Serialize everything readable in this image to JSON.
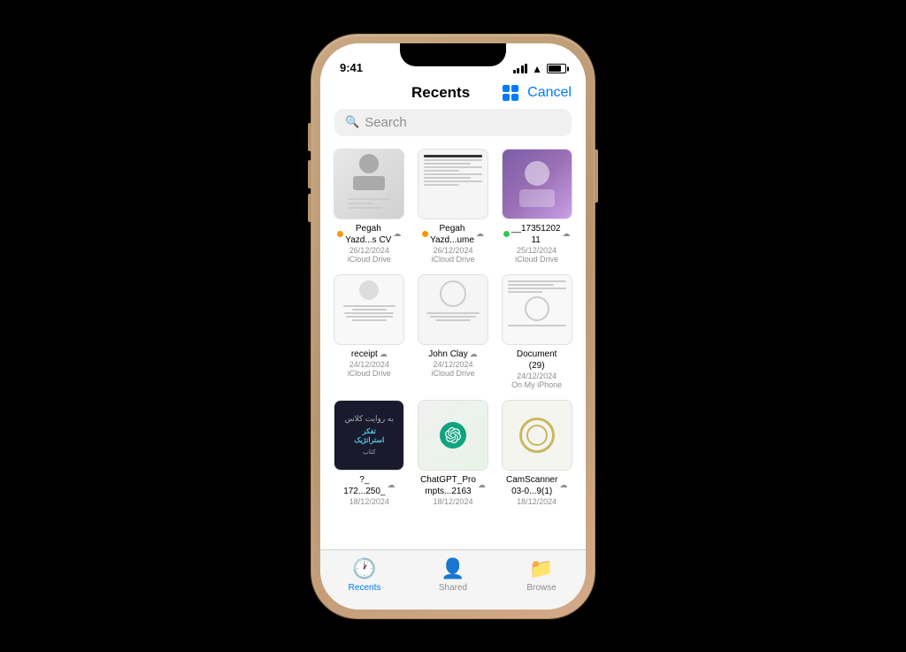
{
  "phone": {
    "status": {
      "time": "9:41",
      "battery_level": 75
    },
    "nav": {
      "title": "Recents",
      "cancel_label": "Cancel"
    },
    "search": {
      "placeholder": "Search"
    },
    "files": [
      {
        "id": "file-1",
        "name": "Pegah\nYazd...s CV",
        "dot_color": "orange",
        "cloud": true,
        "date": "26/12/2024",
        "source": "iCloud Drive",
        "thumb_type": "profile"
      },
      {
        "id": "file-2",
        "name": "Pegah\nYazd...ume",
        "dot_color": "orange",
        "cloud": true,
        "date": "26/12/2024",
        "source": "iCloud Drive",
        "thumb_type": "doc"
      },
      {
        "id": "file-3",
        "name": "__17351202\n11",
        "dot_color": "green",
        "cloud": true,
        "date": "25/12/2024",
        "source": "iCloud Drive",
        "thumb_type": "illustrated"
      },
      {
        "id": "file-4",
        "name": "receipt",
        "dot_color": null,
        "cloud": true,
        "date": "24/12/2024",
        "source": "iCloud Drive",
        "thumb_type": "receipt"
      },
      {
        "id": "file-5",
        "name": "John Clay",
        "dot_color": null,
        "cloud": true,
        "date": "24/12/2024",
        "source": "iCloud Drive",
        "thumb_type": "doc2"
      },
      {
        "id": "file-6",
        "name": "Document\n(29)",
        "dot_color": null,
        "cloud": false,
        "date": "24/12/2024",
        "source": "On My iPhone",
        "thumb_type": "doc3"
      },
      {
        "id": "file-7",
        "name": "?_\n172...250_",
        "dot_color": null,
        "cloud": true,
        "date": "18/12/2024",
        "source": "",
        "thumb_type": "book"
      },
      {
        "id": "file-8",
        "name": "ChatGPT_Pro\nmpts...2163",
        "dot_color": null,
        "cloud": true,
        "date": "18/12/2024",
        "source": "",
        "thumb_type": "chatgpt"
      },
      {
        "id": "file-9",
        "name": "CamScanner\n03-0...9(1)",
        "dot_color": null,
        "cloud": true,
        "date": "18/12/2024",
        "source": "",
        "thumb_type": "camscanner"
      }
    ],
    "tabs": [
      {
        "id": "tab-recents",
        "label": "Recents",
        "icon": "clock",
        "active": true
      },
      {
        "id": "tab-shared",
        "label": "Shared",
        "icon": "person2",
        "active": false
      },
      {
        "id": "tab-browse",
        "label": "Browse",
        "icon": "folder",
        "active": false
      }
    ]
  }
}
